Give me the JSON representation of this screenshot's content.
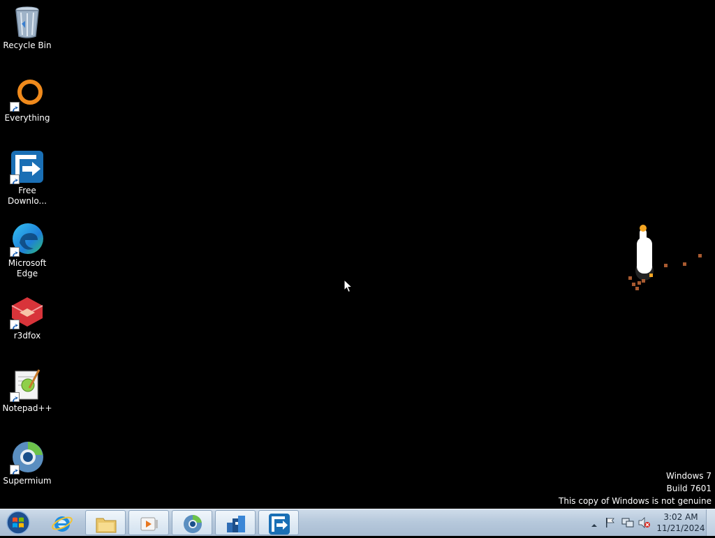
{
  "desktop": {
    "icons": [
      {
        "label": "Recycle Bin",
        "icon": "recycle-bin-icon"
      },
      {
        "label": "Everything",
        "icon": "everything-icon"
      },
      {
        "label": "Free\nDownlo...",
        "icon": "free-download-manager-icon"
      },
      {
        "label": "Microsoft\nEdge",
        "icon": "edge-icon"
      },
      {
        "label": "r3dfox",
        "icon": "r3dfox-icon"
      },
      {
        "label": "Notepad++",
        "icon": "notepad-plus-plus-icon"
      },
      {
        "label": "Supermium",
        "icon": "supermium-icon"
      }
    ]
  },
  "watermark": {
    "line1": "Windows 7",
    "line2": "Build 7601",
    "line3": "This copy of Windows is not genuine"
  },
  "taskbar": {
    "start": "start-orb-icon",
    "pinned": [
      {
        "icon": "internet-explorer-icon"
      },
      {
        "icon": "file-explorer-icon"
      },
      {
        "icon": "media-player-icon"
      },
      {
        "icon": "supermium-taskbar-icon"
      },
      {
        "icon": "app-icon"
      },
      {
        "icon": "free-download-manager-taskbar-icon"
      }
    ],
    "tray": {
      "icons": [
        "show-hidden-icons-icon",
        "action-center-flag-icon",
        "network-icon",
        "volume-muted-icon"
      ],
      "time": "3:02 AM",
      "date": "11/21/2024"
    }
  },
  "colors": {
    "desktop_background": "#000000",
    "taskbar_background": "#b7c9dc",
    "text": "#ffffff"
  }
}
